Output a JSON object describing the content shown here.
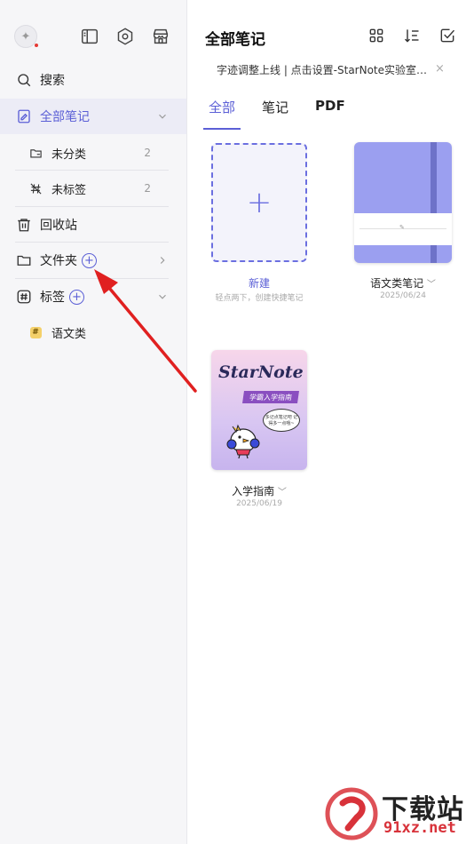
{
  "sidebar": {
    "search": "搜索",
    "all_notes": "全部笔记",
    "uncategorized": "未分类",
    "uncategorized_count": "2",
    "untagged": "未标签",
    "untagged_count": "2",
    "trash": "回收站",
    "folders": "文件夹",
    "folders_add": "+",
    "tags": "标签",
    "tags_add": "+",
    "tag_items": [
      {
        "badge": "#",
        "label": "语文类"
      }
    ]
  },
  "header": {
    "title": "全部笔记"
  },
  "banner": {
    "text": "字迹调整上线 | 点击设置-StarNote实验室开...",
    "close": "×"
  },
  "tabs": [
    {
      "label": "全部",
      "active": true
    },
    {
      "label": "笔记",
      "active": false
    },
    {
      "label": "PDF",
      "active": false
    }
  ],
  "cards": [
    {
      "label": "新建",
      "sub": "轻点两下，创建快捷笔记",
      "symbol": "+"
    },
    {
      "label": "语文类笔记",
      "sub": "2025/06/24",
      "chevron": "﹀"
    },
    {
      "label": "入学指南",
      "sub": "2025/06/19",
      "chevron": "﹀"
    }
  ],
  "guide_cover": {
    "title": "StarNote",
    "ribbon": "学霸入学指南",
    "bubble": "多记点笔记吧\n记得多一点哦~"
  },
  "watermark": {
    "big": "下载站",
    "small": "91xz.net"
  },
  "colors": {
    "accent": "#5b5fd6",
    "notebook": "#9b9ff0",
    "arrow": "#e02020"
  }
}
